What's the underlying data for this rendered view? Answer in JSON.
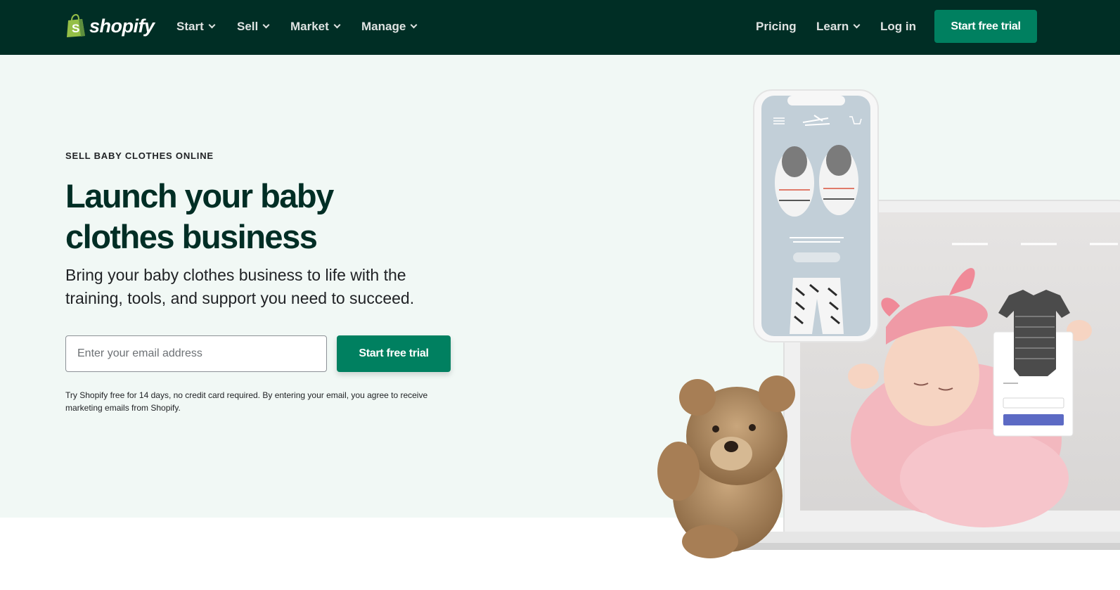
{
  "nav": {
    "brand": "shopify",
    "links": [
      {
        "label": "Start",
        "has_dropdown": true
      },
      {
        "label": "Sell",
        "has_dropdown": true
      },
      {
        "label": "Market",
        "has_dropdown": true
      },
      {
        "label": "Manage",
        "has_dropdown": true
      }
    ],
    "right_links": [
      {
        "label": "Pricing",
        "has_dropdown": false
      },
      {
        "label": "Learn",
        "has_dropdown": true
      },
      {
        "label": "Log in",
        "has_dropdown": false
      }
    ],
    "cta_label": "Start free trial"
  },
  "hero": {
    "eyebrow": "SELL BABY CLOTHES ONLINE",
    "headline_line1": "Launch your baby",
    "headline_line2": "clothes business",
    "subhead": "Bring your baby clothes business to life with the training, tools, and support you need to succeed.",
    "email_placeholder": "Enter your email address",
    "email_value": "",
    "cta_label": "Start free trial",
    "disclaimer": "Try Shopify free for 14 days, no credit card required. By entering your email, you agree to receive marketing emails from Shopify."
  },
  "colors": {
    "nav_bg": "#002e25",
    "hero_bg": "#f1f8f5",
    "brand_green": "#008060",
    "logo_green": "#95bf47",
    "headline": "#002e25"
  },
  "icons": {
    "logo": "shopify-bag-logo",
    "dropdown": "chevron-down-icon",
    "phone_menu": "hamburger-menu-icon",
    "phone_cart": "cart-icon"
  }
}
